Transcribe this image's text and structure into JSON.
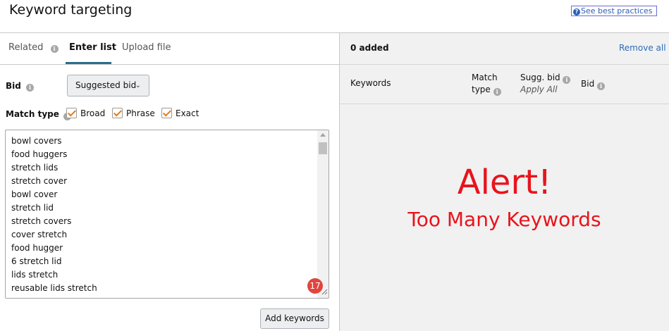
{
  "header": {
    "title": "Keyword targeting",
    "best_practices_label": "See best practices"
  },
  "tabs": [
    {
      "label": "Related",
      "active": false
    },
    {
      "label": "Enter list",
      "active": true
    },
    {
      "label": "Upload file",
      "active": false
    }
  ],
  "form": {
    "bid_label": "Bid",
    "bid_value": "Suggested bid",
    "match_type_label": "Match type",
    "match_types": [
      {
        "label": "Broad",
        "checked": true
      },
      {
        "label": "Phrase",
        "checked": true
      },
      {
        "label": "Exact",
        "checked": true
      }
    ]
  },
  "keyword_input": {
    "items": [
      "bowl covers",
      "food huggers",
      "stretch lids",
      "stretch cover",
      "bowl cover",
      "stretch lid",
      "stretch covers",
      "cover stretch",
      "food hugger",
      "6 stretch lid",
      "lids stretch",
      "reusable lids stretch"
    ],
    "badge_count": "17"
  },
  "add_button_label": "Add keywords",
  "right_panel": {
    "added_count": "0 added",
    "remove_all_label": "Remove all",
    "columns": {
      "keywords": "Keywords",
      "match_type_line1": "Match",
      "match_type_line2": "type",
      "sugg_bid": "Sugg. bid",
      "apply_all": "Apply All",
      "bid": "Bid"
    },
    "alert_title": "Alert!",
    "alert_subtitle": "Too Many Keywords"
  },
  "colors": {
    "accent_orange": "#e47911",
    "link_blue": "#2b6cb8",
    "alert_red": "#e8141c",
    "tab_underline": "#2a6e8c"
  }
}
